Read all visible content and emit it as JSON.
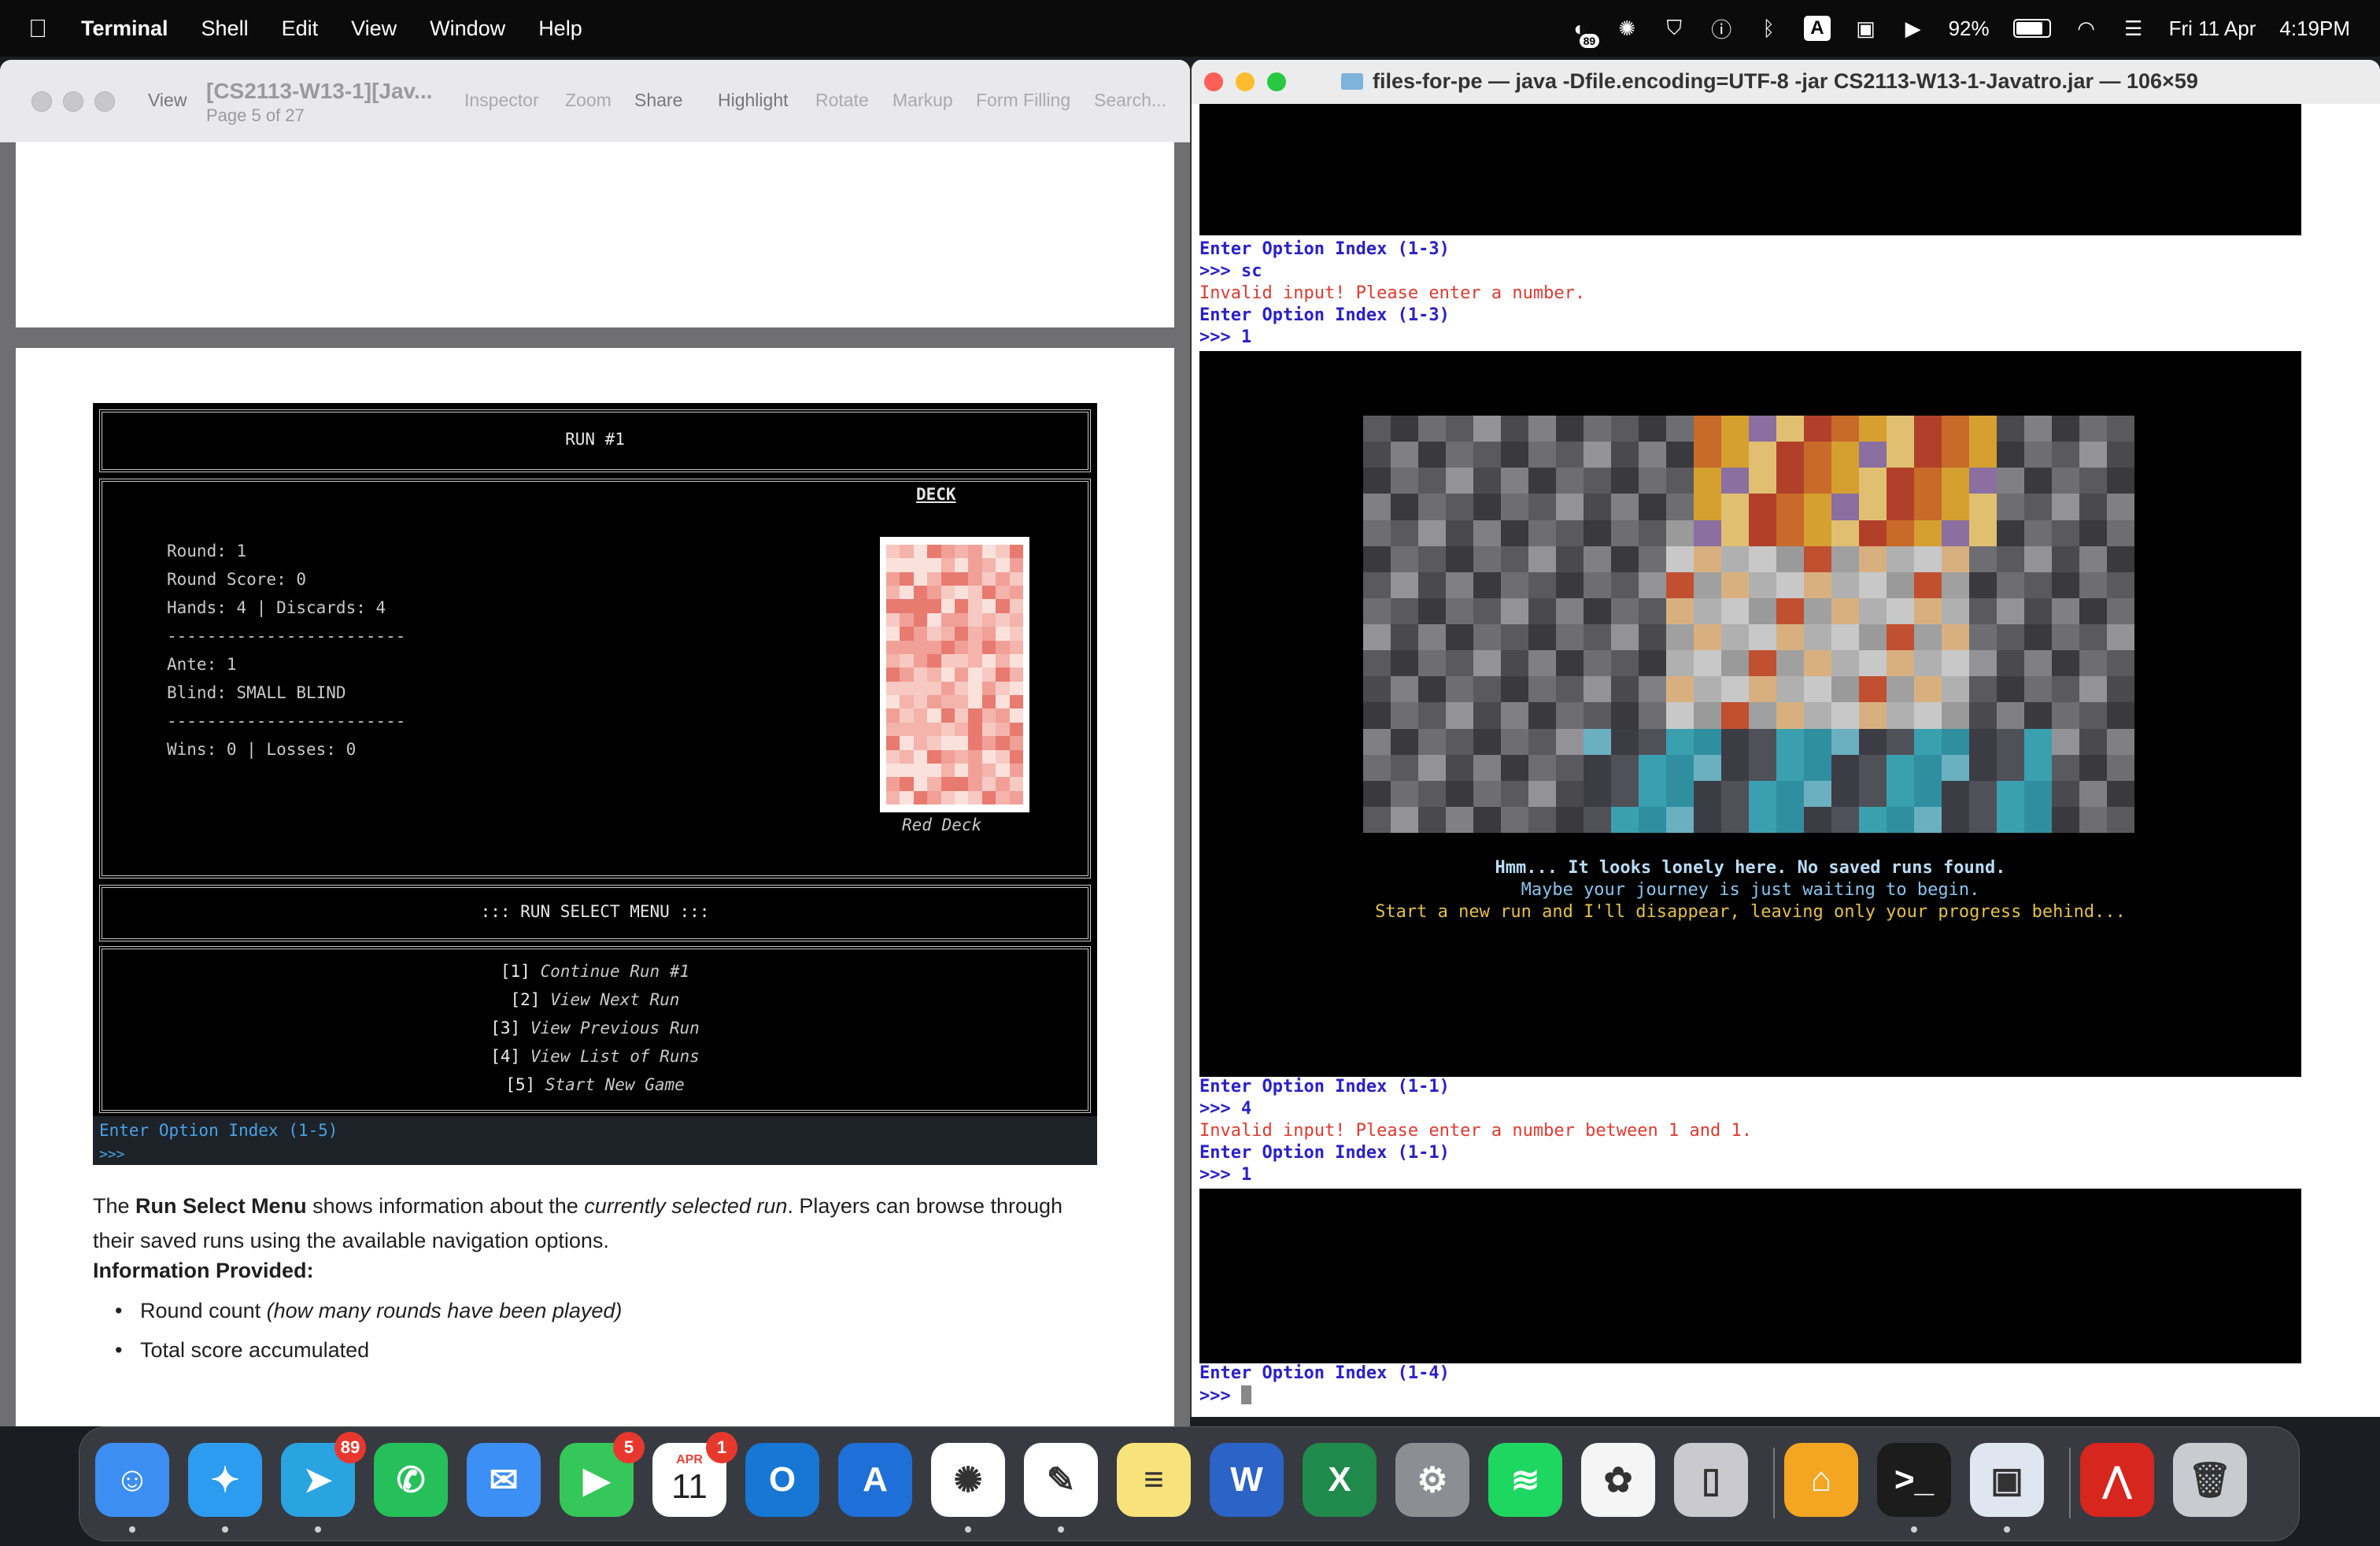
{
  "menubar": {
    "app": "Terminal",
    "items": [
      "Shell",
      "Edit",
      "View",
      "Window",
      "Help"
    ],
    "status": {
      "notif_count": "89",
      "keyboard_input": "A",
      "battery": "92%",
      "battery_level": 0.92,
      "date": "Fri 11 Apr",
      "time": "4:19PM"
    }
  },
  "preview": {
    "title": "[CS2113-W13-1][Jav...",
    "subtitle": "Page 5 of 27",
    "toolbar": {
      "view": "View",
      "inspector": "Inspector",
      "zoom": "Zoom",
      "share": "Share",
      "highlight": "Highlight",
      "rotate": "Rotate",
      "markup": "Markup",
      "form_filling": "Form Filling",
      "search": "Search..."
    },
    "game": {
      "run_title": "RUN #1",
      "deck_label": "DECK",
      "deck_name": "Red Deck",
      "stats": [
        "Round: 1",
        "Round Score: 0",
        "Hands: 4 | Discards: 4",
        "------------------------",
        "Ante: 1",
        "Blind: SMALL BLIND",
        "------------------------",
        "Wins: 0 | Losses: 0"
      ],
      "menu_title": "::: RUN SELECT MENU :::",
      "menu_items": [
        {
          "key": "[1]",
          "label": "Continue Run #1"
        },
        {
          "key": "[2]",
          "label": "View Next Run"
        },
        {
          "key": "[3]",
          "label": "View Previous Run"
        },
        {
          "key": "[4]",
          "label": "View List of Runs"
        },
        {
          "key": "[5]",
          "label": "Start New Game"
        }
      ],
      "prompt": "Enter Option Index (1-5)",
      "prompt_symbol": ">>>"
    },
    "doc": {
      "para_prefix": "The ",
      "para_bold": "Run Select Menu",
      "para_mid": " shows information about the ",
      "para_italic": "currently selected run",
      "para_end": ". Players can browse through their saved runs using the available navigation options.",
      "heading": "Information Provided:",
      "bullet1_text": "Round count ",
      "bullet1_italic": "(how many rounds have been played)",
      "bullet2": "Total score accumulated"
    }
  },
  "terminal": {
    "title": "files-for-pe — java -Dfile.encoding=UTF-8 -jar CS2113-W13-1-Javatro.jar — 106×59",
    "lines": {
      "l1": "Enter Option Index (1-3)",
      "l2": ">>> sc",
      "l3": "Invalid input! Please enter a number.",
      "l4": "Enter Option Index (1-3)",
      "l5": ">>> 1",
      "msg1": "Hmm... It looks lonely here. No saved runs found.",
      "msg2": "Maybe your journey is just waiting to begin.",
      "msg3": "Start a new run and I'll disappear, leaving only your progress behind...",
      "l6": "Enter Option Index (1-1)",
      "l7": ">>> 4",
      "l8": "Invalid input! Please enter a number between 1 and 1.",
      "l9": "Enter Option Index (1-1)",
      "l10": ">>> 1",
      "l11": "Enter Option Index (1-4)",
      "l12": ">>> "
    }
  },
  "dock": {
    "apps": [
      {
        "name": "Finder",
        "glyph": "☺",
        "color": "#3d8ef2"
      },
      {
        "name": "Safari",
        "glyph": "✦",
        "color": "#2c9cf0"
      },
      {
        "name": "Telegram",
        "glyph": "➤",
        "color": "#2aa3e1",
        "badge": "89"
      },
      {
        "name": "WhatsApp",
        "glyph": "✆",
        "color": "#25c05a"
      },
      {
        "name": "Mail",
        "glyph": "✉",
        "color": "#3c8ff5"
      },
      {
        "name": "FaceTime",
        "glyph": "▶",
        "color": "#35c759",
        "badge": "5"
      },
      {
        "name": "Calendar",
        "glyph": "11",
        "color": "#ffffff",
        "label": "APR",
        "badge": "1"
      },
      {
        "name": "Outlook",
        "glyph": "O",
        "color": "#1677d4"
      },
      {
        "name": "Xcode",
        "glyph": "A",
        "color": "#1f6fd8"
      },
      {
        "name": "ChatGPT",
        "glyph": "✺",
        "color": "#ffffff"
      },
      {
        "name": "Freeform",
        "glyph": "✎",
        "color": "#ffffff"
      },
      {
        "name": "Notes",
        "glyph": "≡",
        "color": "#f8e27a"
      },
      {
        "name": "Word",
        "glyph": "W",
        "color": "#2b63c6"
      },
      {
        "name": "Excel",
        "glyph": "X",
        "color": "#1f8a4c"
      },
      {
        "name": "System Settings",
        "glyph": "⚙",
        "color": "#8d8e93"
      },
      {
        "name": "Spotify",
        "glyph": "≋",
        "color": "#1ed760"
      },
      {
        "name": "Photos",
        "glyph": "✿",
        "color": "#f5f5f5"
      },
      {
        "name": "iPhone Mirroring",
        "glyph": "▯",
        "color": "#c9c9cf"
      },
      {
        "name": "Home",
        "glyph": "⌂",
        "color": "#f4a623"
      },
      {
        "name": "Terminal",
        "glyph": ">_",
        "color": "#1c1c1c"
      },
      {
        "name": "Preview",
        "glyph": "▣",
        "color": "#dfe6ef"
      },
      {
        "name": "Acrobat",
        "glyph": "⋀",
        "color": "#d7261e"
      },
      {
        "name": "Trash",
        "glyph": "🗑",
        "color": "#c8cbd0"
      }
    ]
  }
}
